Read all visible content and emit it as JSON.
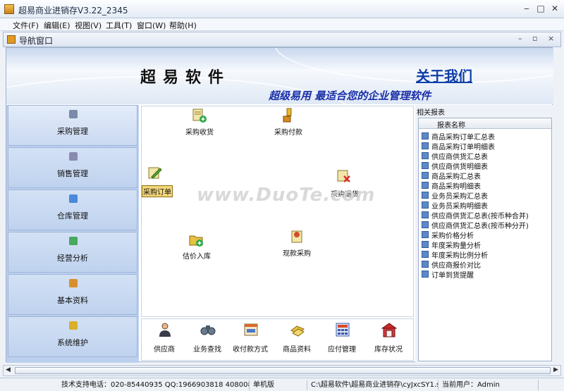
{
  "window": {
    "title": "超易商业进销存V3.22_2345",
    "min": "‒",
    "max": "□",
    "close": "✕"
  },
  "menu": [
    "文件(F)",
    "编辑(E)",
    "视图(V)",
    "工具(T)",
    "窗口(W)",
    "帮助(H)"
  ],
  "nav_window": {
    "title": "导航窗口",
    "btn_min": "–",
    "btn_max": "▫",
    "btn_close": "×"
  },
  "banner": {
    "brand": "超易软件",
    "about": "关于我们",
    "slogan": "超级易用 最适合您的企业管理软件"
  },
  "sidebar": {
    "items": [
      {
        "label": "采购管理",
        "active": true,
        "color": "#7a8aa8"
      },
      {
        "label": "销售管理",
        "active": false,
        "color": "#8a8ab0"
      },
      {
        "label": "仓库管理",
        "active": false,
        "color": "#4a8ad8"
      },
      {
        "label": "经营分析",
        "active": false,
        "color": "#4aa860"
      },
      {
        "label": "基本资料",
        "active": false,
        "color": "#d8902a"
      },
      {
        "label": "系统维护",
        "active": false,
        "color": "#d8b02a"
      }
    ]
  },
  "flow": {
    "receive": "采购收货",
    "payment": "采购付款",
    "order": "采购订单",
    "return": "采购退货",
    "estimate": "估价入库",
    "cash": "现款采购"
  },
  "watermark": "www.DuoTe.com",
  "quick": [
    "供应商",
    "业务查找",
    "收付款方式",
    "商品资料",
    "应付管理",
    "库存状况"
  ],
  "reports": {
    "title": "相关报表",
    "header": "报表名称",
    "items": [
      "商品采购订单汇总表",
      "商品采购订单明细表",
      "供应商供货汇总表",
      "供应商供货明细表",
      "商品采购汇总表",
      "商品采购明细表",
      "业务员采购汇总表",
      "业务员采购明细表",
      "供应商供货汇总表(按币种合并)",
      "供应商供货汇总表(按币种分开)",
      "采购价格分析",
      "年度采购量分析",
      "年度采购比例分析",
      "供应商报价对比",
      "订单到货提醒"
    ]
  },
  "status": {
    "support": "技术支持电话：020-85440935 QQ:1966903818 408008750",
    "mode": "单机版",
    "path": "C:\\超易软件\\超易商业进销存\\cyJxcSY1.sys",
    "user": "当前用户：Admin"
  }
}
